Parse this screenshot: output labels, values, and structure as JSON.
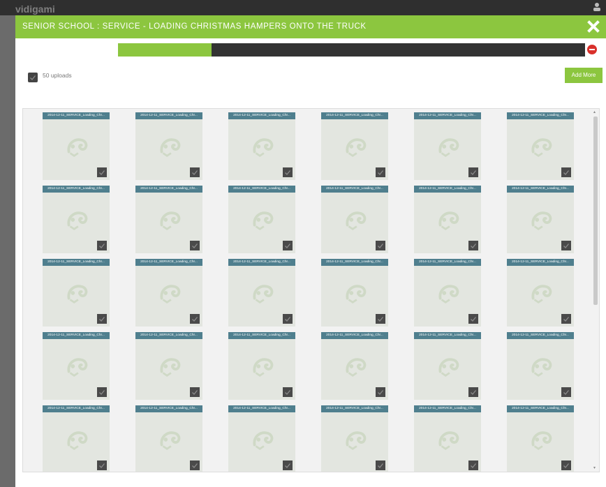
{
  "background": {
    "brand": "vidigami"
  },
  "modal": {
    "title": "SENIOR SCHOOL : SERVICE - LOADING CHRISTMAS HAMPERS ONTO THE TRUCK",
    "close_icon": "close-icon",
    "progress_fraction": 0.2,
    "uploads_label": "50 uploads",
    "add_more_label": "Add More",
    "tile_caption": "2014-12-11_SERVICE_Loading_Chr..."
  },
  "colors": {
    "accent": "#8cc63f",
    "tile_label_bg": "#4f7f8e",
    "cancel": "#d9302b",
    "progress_track": "#333333"
  },
  "grid": {
    "columns": 6,
    "visible_rows": 5
  }
}
